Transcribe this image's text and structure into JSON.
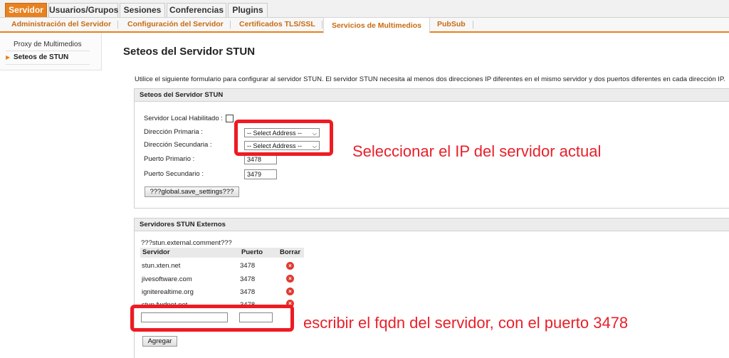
{
  "top_tabs": [
    {
      "label": "Servidor"
    },
    {
      "label": "Usuarios/Grupos"
    },
    {
      "label": "Sesiones"
    },
    {
      "label": "Conferencias"
    },
    {
      "label": "Plugins"
    }
  ],
  "sub_tabs": [
    {
      "label": "Administración del Servidor"
    },
    {
      "label": "Configuración del Servidor"
    },
    {
      "label": "Certificados TLS/SSL"
    },
    {
      "label": "Servicios de Multimedios"
    },
    {
      "label": "PubSub"
    }
  ],
  "sidebar": {
    "items": [
      {
        "label": "Proxy de Multimedios"
      },
      {
        "label": "Seteos de STUN"
      }
    ]
  },
  "page": {
    "title": "Seteos del Servidor STUN",
    "intro": "Utilice el siguiente formulario para configurar al servidor STUN. El servidor STUN necesita al menos dos direcciones IP diferentes en el mismo servidor y dos puertos diferentes en cada dirección IP."
  },
  "settings_panel": {
    "title": "Seteos del Servidor STUN",
    "local_enabled_label": "Servidor Local Habilitado :",
    "local_enabled": false,
    "primary_address_label": "Dirección Primaria :",
    "primary_address_value": "-- Select Address --",
    "secondary_address_label": "Dirección Secundaria :",
    "secondary_address_value": "-- Select Address --",
    "primary_port_label": "Puerto Primario :",
    "primary_port_value": "3478",
    "secondary_port_label": "Puerto Secundario :",
    "secondary_port_value": "3479",
    "save_button": "???global.save_settings???"
  },
  "external_panel": {
    "title": "Servidores STUN Externos",
    "comment": "???stun.external.comment???",
    "columns": {
      "server": "Servidor",
      "port": "Puerto",
      "delete": "Borrar"
    },
    "rows": [
      {
        "server": "stun.xten.net",
        "port": "3478"
      },
      {
        "server": "jivesoftware.com",
        "port": "3478"
      },
      {
        "server": "igniterealtime.org",
        "port": "3478"
      },
      {
        "server": "stun.fwdnet.net",
        "port": "3478"
      }
    ],
    "new_server_value": "",
    "new_port_value": "",
    "add_button": "Agregar"
  },
  "annotations": {
    "select_ip": "Seleccionar el IP del servidor actual",
    "fqdn": "escribir el fqdn del servidor, con el puerto 3478"
  },
  "colors": {
    "accent": "#e8811f",
    "annotation": "#ee1b23",
    "delete_icon": "#e03a2f"
  }
}
